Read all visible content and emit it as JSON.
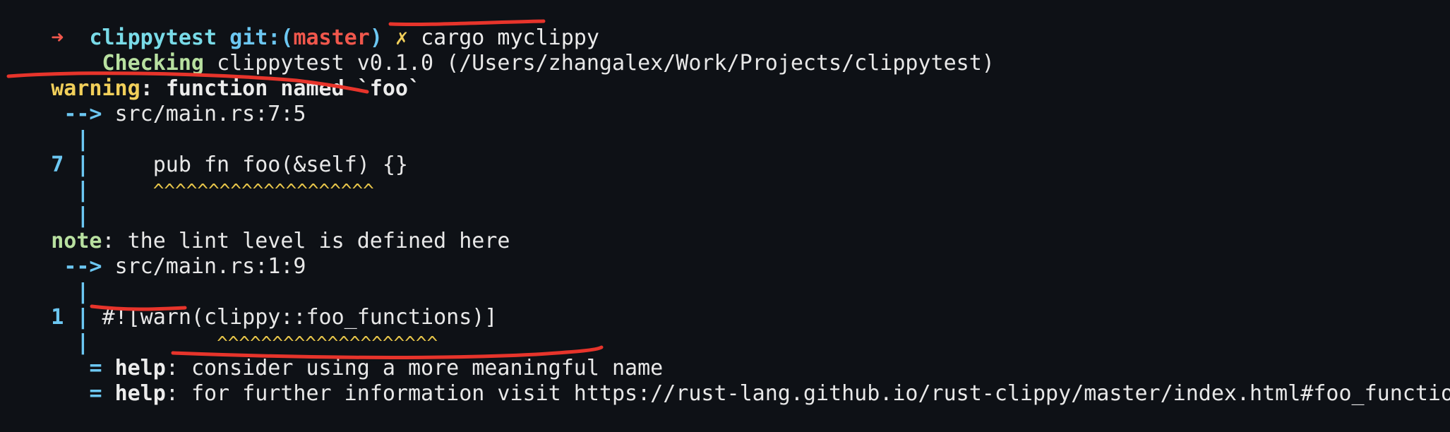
{
  "colors": {
    "background": "#0e1116",
    "prompt_arrow": "#f0574c",
    "warning": "#f1cf5a",
    "note": "#b8e0a0",
    "gutter": "#6cc7f2",
    "caret": "#e8c64a",
    "annotation": "#e7342b"
  },
  "prompt": {
    "arrow": "➜",
    "dir": "clippytest",
    "git_prefix": "git:(",
    "branch": "master",
    "git_suffix": ")",
    "dirty_mark": "✗",
    "command": "cargo myclippy"
  },
  "checking": {
    "label": "Checking",
    "text": "clippytest v0.1.0 (/Users/zhangalex/Work/Projects/clippytest)"
  },
  "warning": {
    "label": "warning",
    "colon": ":",
    "message": "function named `foo`",
    "location_arrow": "-->",
    "location": "src/main.rs:7:5",
    "gutter": "|",
    "line_no": "7",
    "code": "pub fn foo(&self) {}",
    "carets": "^^^^^^^^^^^^^^^^^^^^"
  },
  "note": {
    "label": "note",
    "colon": ":",
    "message": "the lint level is defined here",
    "location_arrow": "-->",
    "location": "src/main.rs:1:9",
    "gutter": "|",
    "line_no": "1",
    "code": "#![warn(clippy::foo_functions)]",
    "carets": "^^^^^^^^^^^^^^^^^^^^"
  },
  "help": [
    {
      "eq": "=",
      "label": "help",
      "colon": ":",
      "message": "consider using a more meaningful name"
    },
    {
      "eq": "=",
      "label": "help",
      "colon": ":",
      "message": "for further information visit https://rust-lang.github.io/rust-clippy/master/index.html#foo_functions"
    }
  ]
}
